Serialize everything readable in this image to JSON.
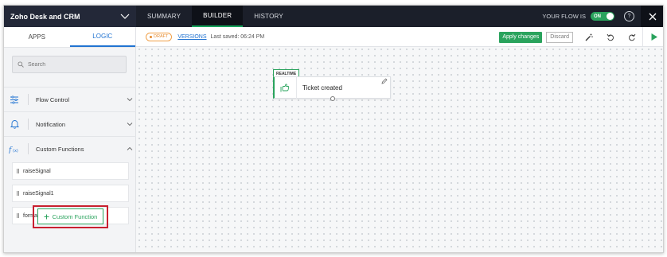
{
  "app": {
    "title": "Zoho Desk and CRM"
  },
  "nav": {
    "tabs": [
      {
        "label": "SUMMARY"
      },
      {
        "label": "BUILDER"
      },
      {
        "label": "HISTORY"
      }
    ],
    "active_tab": "BUILDER"
  },
  "flow_status": {
    "label": "YOUR FLOW IS",
    "toggle": "ON"
  },
  "left_panel": {
    "tabs": [
      {
        "label": "APPS"
      },
      {
        "label": "LOGIC"
      }
    ],
    "active_tab": "LOGIC",
    "search": {
      "placeholder": "Search"
    },
    "sections": [
      {
        "label": "Flow Control",
        "expanded": false
      },
      {
        "label": "Notification",
        "expanded": false
      },
      {
        "label": "Custom Functions",
        "expanded": true
      }
    ],
    "functions": [
      {
        "label": "raiseSignal"
      },
      {
        "label": "raiseSignal1"
      },
      {
        "label": "formatDate"
      }
    ],
    "custom_function_button": "Custom Function"
  },
  "toolbar": {
    "status_badge": "DRAFT",
    "versions_label": "VERSIONS",
    "last_saved": "Last saved: 06:24 PM",
    "apply_label": "Apply changes",
    "discard_label": "Discard"
  },
  "canvas": {
    "trigger": {
      "tag": "REALTIME",
      "label": "Ticket created"
    }
  },
  "colors": {
    "accent_green": "#2aa35d",
    "link_blue": "#2173d1",
    "topbar": "#1b1f2a",
    "highlight_red": "#c8202f",
    "draft_orange": "#e58a2e"
  },
  "icons": [
    "chevron-down-icon",
    "help-icon",
    "close-icon",
    "search-icon",
    "sliders-icon",
    "bell-icon",
    "function-icon",
    "chevron-up-icon",
    "plus-icon",
    "magic-wand-icon",
    "undo-icon",
    "redo-icon",
    "play-icon",
    "trigger-icon",
    "edit-icon"
  ]
}
